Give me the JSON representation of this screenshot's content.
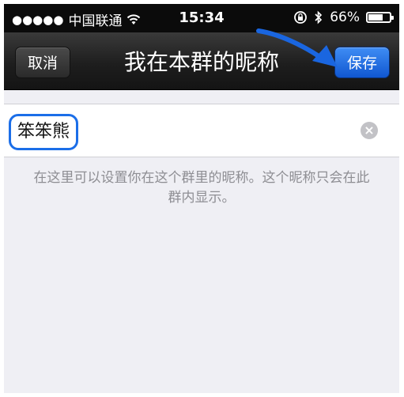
{
  "status_bar": {
    "signal": "●●●●●",
    "carrier": "中国联通",
    "wifi_icon": "wifi-icon",
    "time": "15:34",
    "lock_icon": "rotation-lock-icon",
    "bluetooth_icon": "bluetooth-icon",
    "battery_percent": "66%",
    "battery_level": 0.66
  },
  "navbar": {
    "cancel_label": "取消",
    "title": "我在本群的昵称",
    "save_label": "保存"
  },
  "nickname_field": {
    "value": "笨笨熊",
    "clear_icon": "clear-icon"
  },
  "hint_text": "在这里可以设置你在这个群里的昵称。这个昵称只会在此群内显示。",
  "colors": {
    "accent": "#1b6ee8",
    "save_button": "#1a64df",
    "navbar": "#1e1e1e",
    "background": "#efeff4"
  }
}
